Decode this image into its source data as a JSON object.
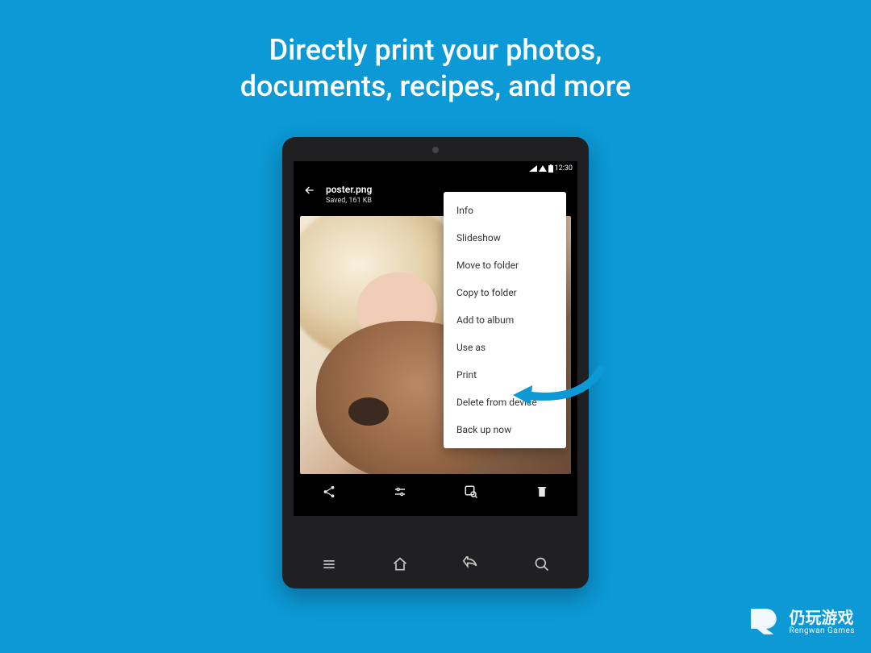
{
  "headline": {
    "line1": "Directly print your photos,",
    "line2": "documents, recipes, and more"
  },
  "statusbar": {
    "time": "12:30"
  },
  "file": {
    "name": "poster.png",
    "info": "Saved, 161 KB"
  },
  "menu": {
    "items": [
      "Info",
      "Slideshow",
      "Move to folder",
      "Copy to folder",
      "Add to album",
      "Use as",
      "Print",
      "Delete from device",
      "Back up now"
    ]
  },
  "watermark": {
    "cn": "仍玩游戏",
    "en": "Rengwan Games"
  },
  "colors": {
    "accent": "#0c99d5",
    "arrow": "#0c99d5"
  }
}
